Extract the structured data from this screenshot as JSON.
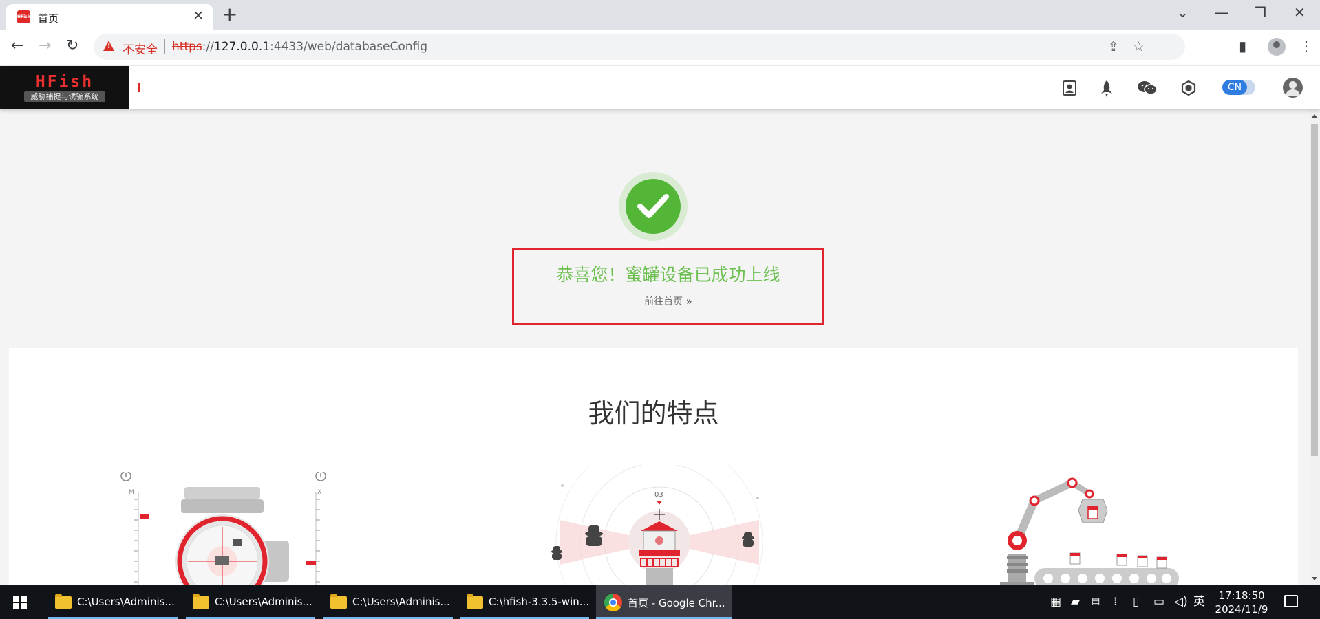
{
  "browser": {
    "tab": {
      "favicon_text": "HFish",
      "title": "首页",
      "close": "✕"
    },
    "new_tab": "+",
    "window_controls": {
      "minimize": "—",
      "maximize": "❐",
      "close": "✕",
      "tab_search": "⌄"
    },
    "address_bar": {
      "security_label": "不安全",
      "url_scheme": "https",
      "url_sep": "://",
      "url_host": "127.0.0.1",
      "url_rest": ":4433/web/databaseConfig"
    }
  },
  "app": {
    "logo": {
      "title": "HFish",
      "subtitle": "威胁捕捉与诱骗系统"
    },
    "language_toggle": "CN",
    "header_icons": [
      "profile-card-icon",
      "rocket-icon",
      "wechat-icon",
      "hexagon-settings-icon",
      "user-avatar-icon"
    ],
    "success": {
      "message": "恭喜您！蜜罐设备已成功上线",
      "link_label": "前往首页",
      "link_chevron": "»",
      "accent_color": "#6bbf4e",
      "highlight_color": "#e0232c"
    },
    "features": {
      "title": "我们的特点",
      "illustrations": [
        "gauge-illustration",
        "watchtower-illustration",
        "robot-arm-illustration"
      ],
      "gauge": {
        "scale_left": "M",
        "scale_right": "X"
      },
      "tower": {
        "label": "03"
      }
    }
  },
  "taskbar": {
    "items": [
      {
        "label": "C:\\Users\\Adminis...",
        "icon": "folder-icon"
      },
      {
        "label": "C:\\Users\\Adminis...",
        "icon": "folder-icon"
      },
      {
        "label": "C:\\Users\\Adminis...",
        "icon": "folder-icon"
      },
      {
        "label": "C:\\hfish-3.3.5-win...",
        "icon": "folder-icon"
      },
      {
        "label": "首页 - Google Chr...",
        "icon": "chrome-icon"
      }
    ],
    "ime": "英",
    "time": "17:18:50",
    "date": "2024/11/9"
  }
}
